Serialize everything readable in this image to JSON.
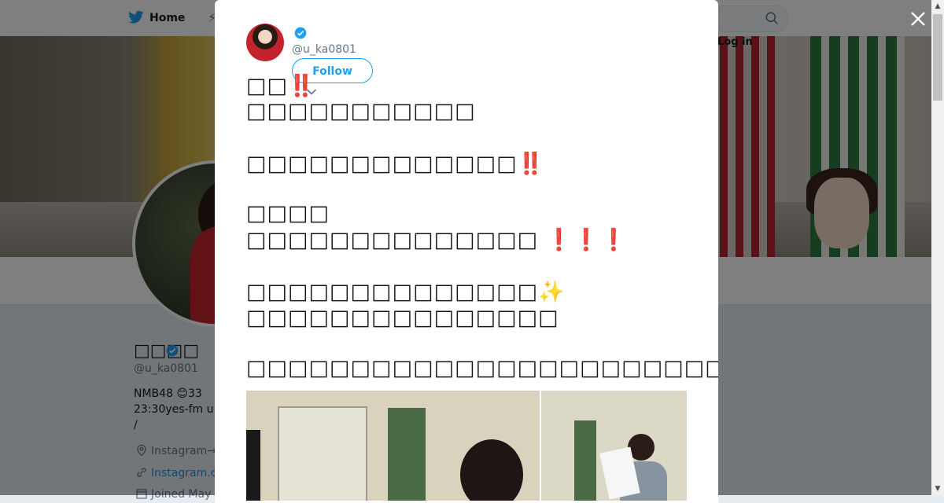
{
  "nav": {
    "home_label": "Home",
    "login_label": "Log in"
  },
  "profile": {
    "name": "□□□□",
    "handle": "@u_ka0801",
    "bio_line1": "NMB48  😊33",
    "bio_line2": "23:30yes-fm u",
    "bio_line3": "/",
    "location": "Instagram→",
    "link": "Instagram.c",
    "joined": "Joined May"
  },
  "tweet": {
    "handle": "@u_ka0801",
    "follow_label": "Follow",
    "lines": {
      "l1": "□□",
      "l1_ex": "‼️",
      "l2": "□□□□□□□□□□□",
      "l3": "□□□□□□□□□□□□□",
      "l3_ex": "‼️",
      "l4": "□□□□",
      "l5": "□□□□□□□□□□□□□□",
      "l5_ex": "❗️❗️❗️",
      "l6": "□□□□□□□□□□□□□□",
      "l6_emoji": "✨",
      "l7": "□□□□□□□□□□□□□□□",
      "l8": "□□□□□□□□□□□□□□□□□□□□□□□□□",
      "l8_emoji": "💭"
    }
  },
  "colors": {
    "accent": "#1da1f2",
    "verified": "#1da1f2",
    "exclaim": "#c0172b"
  },
  "icons": {
    "nav_bird": "twitter-bird-icon",
    "close": "close-icon",
    "verified": "verified-badge-icon",
    "caret": "chevron-down-icon",
    "search": "search-icon"
  }
}
